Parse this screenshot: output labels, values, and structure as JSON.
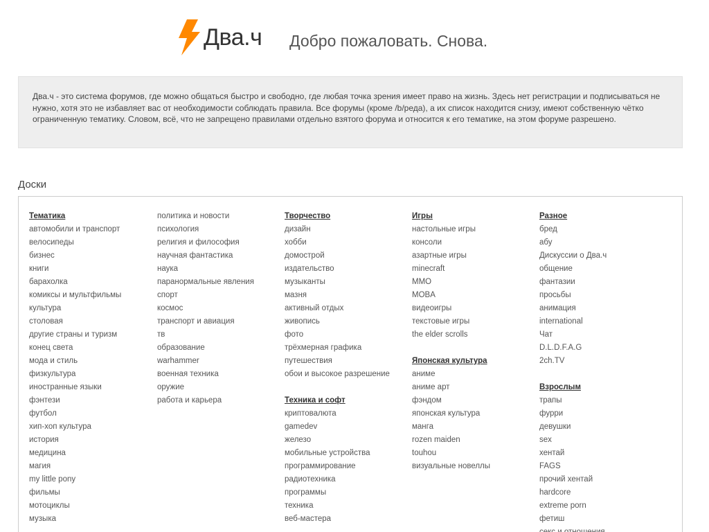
{
  "header": {
    "logo_text": "Два.ч",
    "tagline": "Добро пожаловать. Снова.",
    "logo_color": "#ff8800"
  },
  "intro": {
    "text": "Два.ч - это система форумов, где можно общаться быстро и свободно, где любая точка зрения имеет право на жизнь. Здесь нет регистрации и подписываться не нужно, хотя это не избавляет вас от необходимости соблюдать правила. Все форумы (кроме /b/реда), а их список находится снизу, имеют собственную чётко ограниченную тематику. Словом, всё, что не запрещено правилами отдельно взятого форума и относится к его тематике, на этом форуме разрешено."
  },
  "boards": {
    "title": "Доски",
    "columns": [
      {
        "groups": [
          {
            "title": "Тематика",
            "items": [
              "автомобили и транспорт",
              "велосипеды",
              "бизнес",
              "книги",
              "барахолка",
              "комиксы и мультфильмы",
              "культура",
              "столовая",
              "другие страны и туризм",
              "конец света",
              "мода и стиль",
              "физкультура",
              "иностранные языки",
              "фэнтези",
              "футбол",
              "хип-хоп культура",
              "история",
              "медицина",
              "магия",
              "my little pony",
              "фильмы",
              "мотоциклы",
              "музыка"
            ]
          }
        ]
      },
      {
        "groups": [
          {
            "title": "",
            "items": [
              "политика и новости",
              "психология",
              "религия и философия",
              "научная фантастика",
              "наука",
              "паранормальные явления",
              "спорт",
              "космос",
              "транспорт и авиация",
              "тв",
              "образование",
              "warhammer",
              "военная техника",
              "оружие",
              "работа и карьера"
            ]
          }
        ]
      },
      {
        "groups": [
          {
            "title": "Творчество",
            "items": [
              "дизайн",
              "хобби",
              "домострой",
              "издательство",
              "музыканты",
              "мазня",
              "активный отдых",
              "живопись",
              "фото",
              "трёхмерная графика",
              "путешествия",
              "обои и высокое разрешение"
            ]
          },
          {
            "title": "Техника и софт",
            "items": [
              "криптовалюта",
              "gamedev",
              "железо",
              "мобильные устройства",
              "программирование",
              "радиотехника",
              "программы",
              "техника",
              "веб-мастера"
            ]
          }
        ]
      },
      {
        "groups": [
          {
            "title": "Игры",
            "items": [
              "настольные игры",
              "консоли",
              "азартные игры",
              "minecraft",
              "MMO",
              "MOBA",
              "видеоигры",
              "текстовые игры",
              "the elder scrolls"
            ]
          },
          {
            "title": "Японская культура",
            "items": [
              "аниме",
              "аниме арт",
              "фэндом",
              "японская культура",
              "манга",
              "rozen maiden",
              "touhou",
              "визуальные новеллы"
            ]
          }
        ]
      },
      {
        "groups": [
          {
            "title": "Разное",
            "items": [
              "бред",
              "абу",
              "Дискуссии о Два.ч",
              "общение",
              "фантазии",
              "просьбы",
              "анимация",
              "international",
              "Чат",
              "D.L.D.F.A.G",
              "2ch.TV"
            ]
          },
          {
            "title": "Взрослым",
            "items": [
              "трапы",
              "фурри",
              "девушки",
              "sex",
              "хентай",
              "FAGS",
              "прочий хентай",
              "hardcore",
              "extreme porn",
              "фетиш",
              "секс и отношения"
            ]
          }
        ]
      }
    ]
  }
}
